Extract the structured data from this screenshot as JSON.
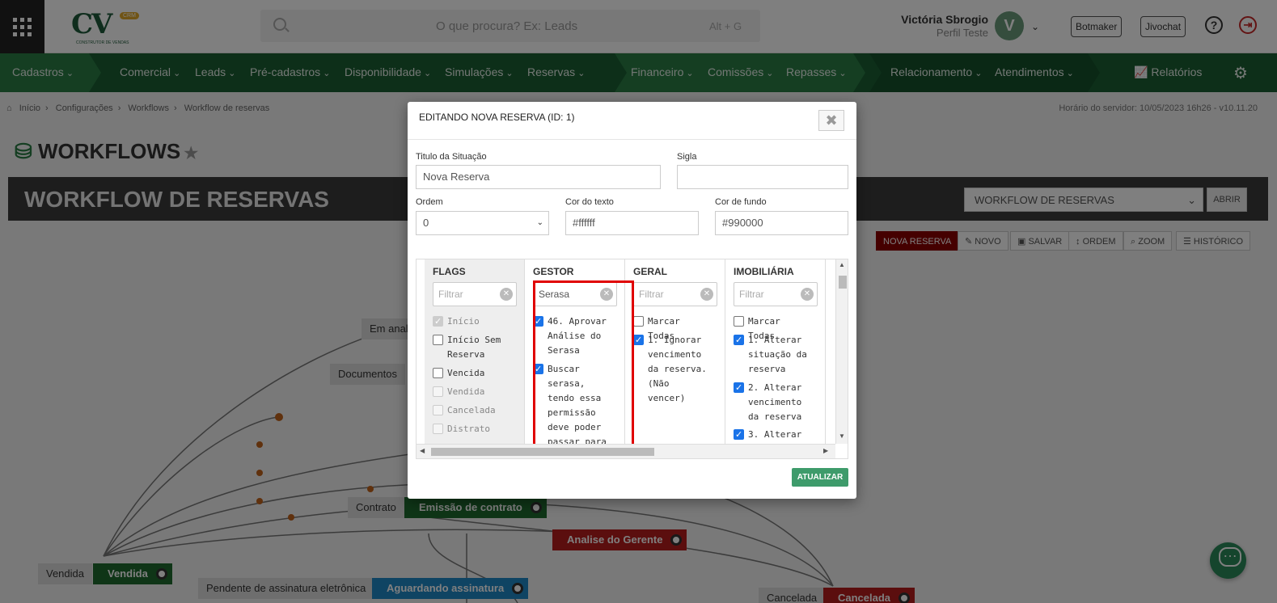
{
  "header": {
    "search_placeholder": "O que procura? Ex: Leads",
    "search_shortcut": "Alt + G",
    "logo_text": "CV",
    "logo_badge": "CRM",
    "logo_sub": "CONSTRUTOR DE VENDAS",
    "user_name": "Victória Sbrogio",
    "user_profile": "Perfil Teste",
    "avatar_initial": "V",
    "botmaker": "Botmaker",
    "jivochat": "Jivochat",
    "help_icon": "?",
    "logout_icon": "⇥"
  },
  "nav": {
    "items": [
      "Cadastros",
      "Comercial",
      "Leads",
      "Pré-cadastros",
      "Disponibilidade",
      "Simulações",
      "Reservas",
      "Financeiro",
      "Comissões",
      "Repasses",
      "Relacionamento",
      "Atendimentos"
    ],
    "reports": "Relatórios",
    "reports_icon": "chart-line-icon",
    "settings_icon": "gear-icon"
  },
  "breadcrumb": [
    "Início",
    "Configurações",
    "Workflows",
    "Workflow de reservas"
  ],
  "server_time": "Horário do servidor: 10/05/2023 16h26 - v10.11.20",
  "page": {
    "title": "WORKFLOWS",
    "banner_title": "WORKFLOW DE RESERVAS",
    "select_value": "WORKFLOW DE RESERVAS",
    "abrir": "ABRIR"
  },
  "toolbar": {
    "nova_reserva": "NOVA RESERVA",
    "novo": "NOVO",
    "salvar": "SALVAR",
    "ordem": "ORDEM",
    "zoom": "ZOOM",
    "historico": "HISTÓRICO"
  },
  "canvas": {
    "labels": {
      "em_analise": "Em anal",
      "documentos": "Documentos",
      "contrato": "Contrato",
      "vendida_label": "Vendida",
      "pendente": "Pendente de assinatura eletrônica",
      "cancelada_label": "Cancelada"
    },
    "nodes": {
      "emissao": "Emissão de contrato",
      "analise_gerente": "Analise do Gerente",
      "vendida": "Vendida",
      "aguardando": "Aguardando assinatura",
      "cancelada": "Cancelada"
    },
    "colors": {
      "green": "#1f6b2f",
      "red": "#b71c1c",
      "blue": "#1e88c7"
    }
  },
  "modal": {
    "title": "EDITANDO NOVA RESERVA (ID: 1)",
    "close": "✖",
    "fields": {
      "titulo_label": "Titulo da Situação",
      "titulo_value": "Nova Reserva",
      "sigla_label": "Sigla",
      "sigla_value": "",
      "ordem_label": "Ordem",
      "ordem_value": "0",
      "cor_texto_label": "Cor do texto",
      "cor_texto_value": "#ffffff",
      "cor_fundo_label": "Cor de fundo",
      "cor_fundo_value": "#990000"
    },
    "filter_placeholder": "Filtrar",
    "columns": {
      "flags": {
        "title": "FLAGS",
        "items": [
          {
            "label": "Início",
            "checked": true,
            "disabled": true
          },
          {
            "label": "Início Sem Reserva",
            "checked": false,
            "disabled": false
          },
          {
            "label": "Vencida",
            "checked": false,
            "disabled": false
          },
          {
            "label": "Vendida",
            "checked": false,
            "disabled": true
          },
          {
            "label": "Cancelada",
            "checked": false,
            "disabled": true
          },
          {
            "label": "Distrato",
            "checked": false,
            "disabled": true
          }
        ]
      },
      "gestor": {
        "title": "GESTOR",
        "filter_value": "Serasa",
        "items": [
          {
            "label": "46. Aprovar Análise do Serasa",
            "checked": true
          },
          {
            "label": "Buscar serasa, tendo essa permissão deve poder passar para página do Serasa sem",
            "checked": true
          }
        ]
      },
      "geral": {
        "title": "GERAL",
        "items": [
          {
            "label": "Marcar Todas",
            "checked": false
          },
          {
            "label": "1. Ignorar vencimento da reserva. (Não vencer)",
            "checked": true
          }
        ]
      },
      "imobiliaria": {
        "title": "IMOBILIÁRIA",
        "items": [
          {
            "label": "Marcar Todas",
            "checked": false
          },
          {
            "label": "1. Alterar situação da reserva",
            "checked": true
          },
          {
            "label": "2. Alterar vencimento da reserva",
            "checked": true
          },
          {
            "label": "3. Alterar",
            "checked": true
          }
        ]
      }
    },
    "update_button": "ATUALIZAR"
  }
}
